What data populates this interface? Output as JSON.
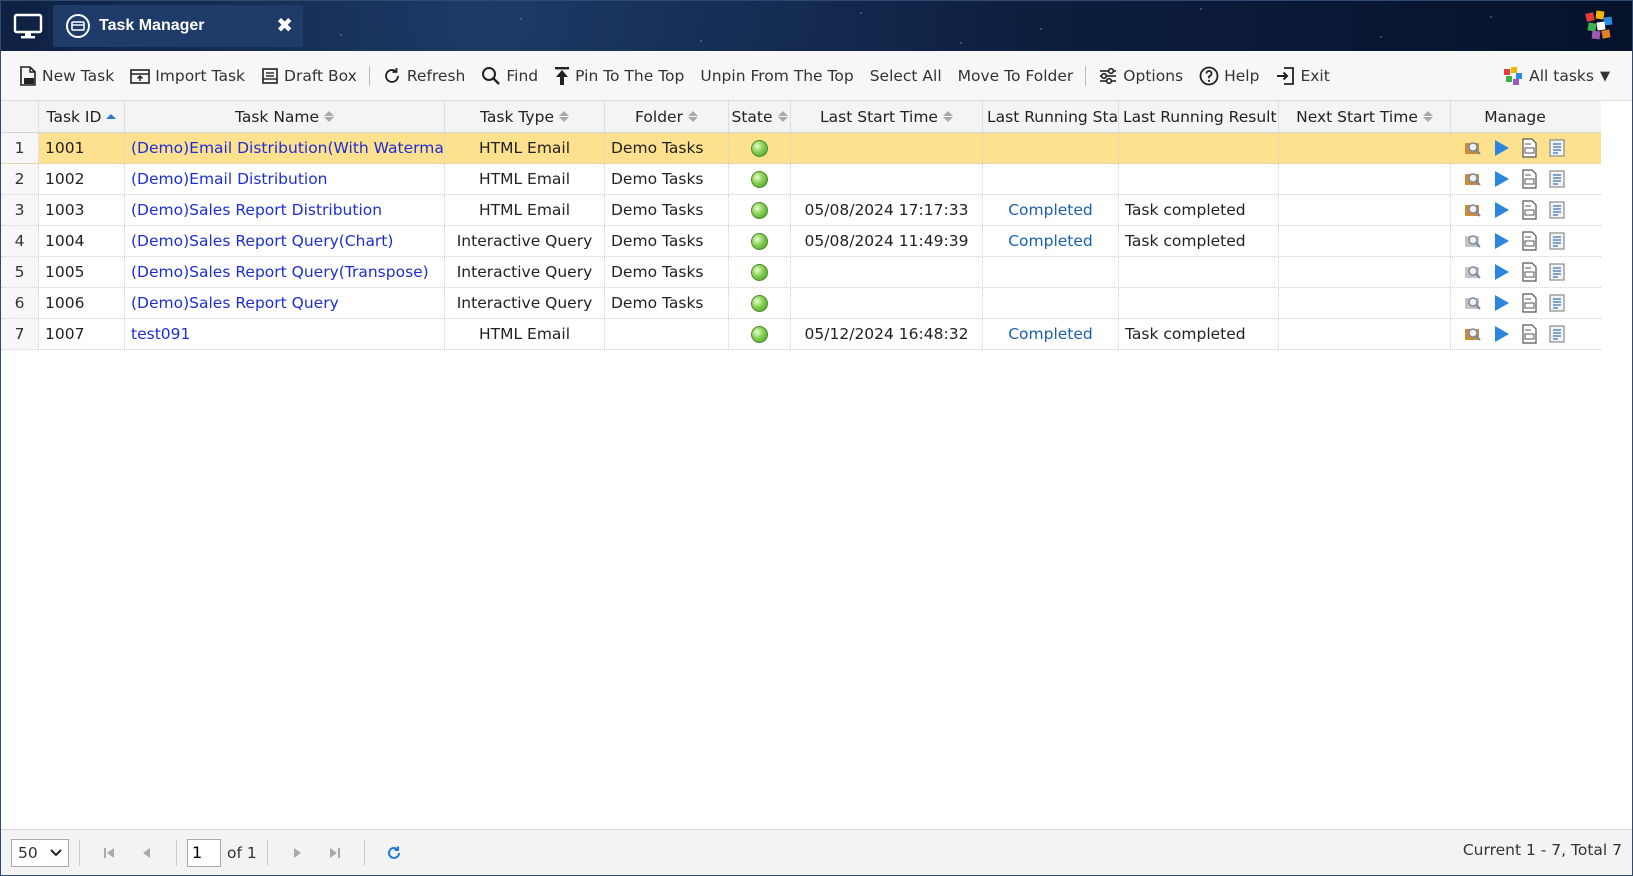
{
  "window": {
    "tab_title": "Task Manager",
    "close_glyph": "✖"
  },
  "toolbar": {
    "new_task": "New Task",
    "import_task": "Import Task",
    "draft_box": "Draft Box",
    "refresh": "Refresh",
    "find": "Find",
    "pin_top": "Pin To The Top",
    "unpin_top": "Unpin From The Top",
    "select_all": "Select All",
    "move_folder": "Move To Folder",
    "options": "Options",
    "help": "Help",
    "exit": "Exit",
    "all_tasks": "All tasks",
    "all_tasks_caret": "▼"
  },
  "table": {
    "columns": [
      "Task ID",
      "Task Name",
      "Task Type",
      "Folder",
      "State",
      "Last Start Time",
      "Last Running State",
      "Last Running Result",
      "Next Start Time",
      "Manage"
    ],
    "rows": [
      {
        "n": "1",
        "id": "1001",
        "name": "(Demo)Email Distribution(With Watermark)",
        "type": "HTML Email",
        "folder": "Demo Tasks",
        "last_start": "",
        "run_state": "",
        "run_result": "",
        "next_start": ""
      },
      {
        "n": "2",
        "id": "1002",
        "name": "(Demo)Email Distribution",
        "type": "HTML Email",
        "folder": "Demo Tasks",
        "last_start": "",
        "run_state": "",
        "run_result": "",
        "next_start": ""
      },
      {
        "n": "3",
        "id": "1003",
        "name": "(Demo)Sales Report Distribution",
        "type": "HTML Email",
        "folder": "Demo Tasks",
        "last_start": "05/08/2024 17:17:33",
        "run_state": "Completed",
        "run_result": "Task completed",
        "next_start": ""
      },
      {
        "n": "4",
        "id": "1004",
        "name": "(Demo)Sales Report Query(Chart)",
        "type": "Interactive Query",
        "folder": "Demo Tasks",
        "last_start": "05/08/2024 11:49:39",
        "run_state": "Completed",
        "run_result": "Task completed",
        "next_start": ""
      },
      {
        "n": "5",
        "id": "1005",
        "name": "(Demo)Sales Report Query(Transpose)",
        "type": "Interactive Query",
        "folder": "Demo Tasks",
        "last_start": "",
        "run_state": "",
        "run_result": "",
        "next_start": ""
      },
      {
        "n": "6",
        "id": "1006",
        "name": "(Demo)Sales Report Query",
        "type": "Interactive Query",
        "folder": "Demo Tasks",
        "last_start": "",
        "run_state": "",
        "run_result": "",
        "next_start": ""
      },
      {
        "n": "7",
        "id": "1007",
        "name": "test091",
        "type": "HTML Email",
        "folder": "",
        "last_start": "05/12/2024 16:48:32",
        "run_state": "Completed",
        "run_result": "Task completed",
        "next_start": ""
      }
    ]
  },
  "pager": {
    "page_size": "50",
    "page": "1",
    "of_label": "of 1",
    "info": "Current 1 - 7, Total 7"
  },
  "colors": {
    "selected_row": "#fde18e",
    "link": "#1d2fd3",
    "status": "#1a5fb4",
    "topbar": "#0c1d3d"
  }
}
